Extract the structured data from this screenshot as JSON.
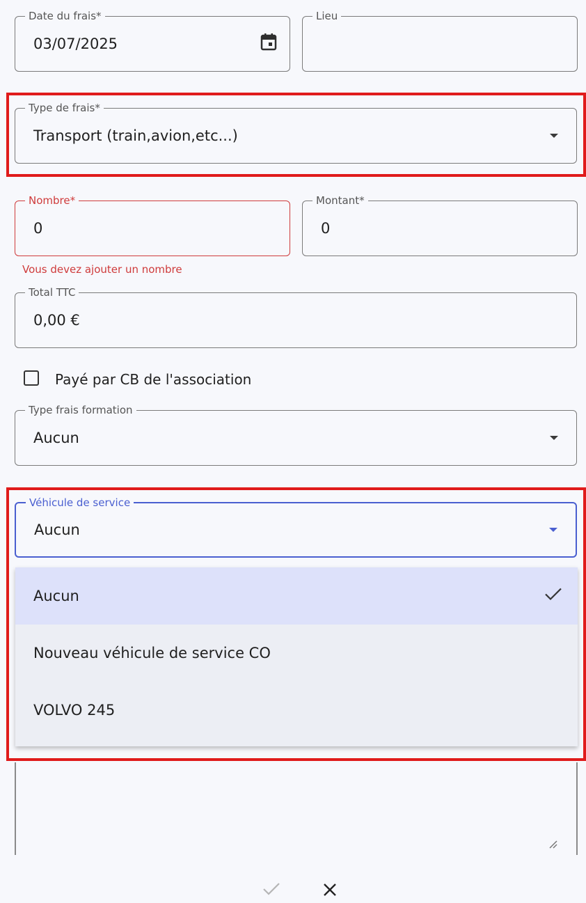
{
  "form": {
    "date": {
      "label": "Date du frais*",
      "value": "03/07/2025",
      "icon": "calendar-icon"
    },
    "lieu": {
      "label": "Lieu",
      "value": ""
    },
    "type_frais": {
      "label": "Type de frais*",
      "value": "Transport (train,avion,etc...)"
    },
    "nombre": {
      "label": "Nombre*",
      "value": "0",
      "error": "Vous devez ajouter un nombre"
    },
    "montant": {
      "label": "Montant*",
      "value": "0"
    },
    "total": {
      "label": "Total TTC",
      "value": "0,00 €"
    },
    "paye_cb": {
      "label": "Payé par CB de l'association",
      "checked": false
    },
    "type_formation": {
      "label": "Type frais formation",
      "value": "Aucun"
    },
    "vehicule": {
      "label": "Véhicule de service",
      "value": "Aucun",
      "options": [
        {
          "label": "Aucun",
          "selected": true
        },
        {
          "label": "Nouveau véhicule de service CO",
          "selected": false
        },
        {
          "label": "VOLVO 245",
          "selected": false
        }
      ]
    }
  },
  "actions": {
    "confirm_icon": "check-icon",
    "cancel_icon": "close-icon"
  },
  "colors": {
    "highlight": "#e01b1b",
    "error": "#cf3b3b",
    "focus": "#4a5fd0",
    "selected_option_bg": "#dde1fa"
  }
}
